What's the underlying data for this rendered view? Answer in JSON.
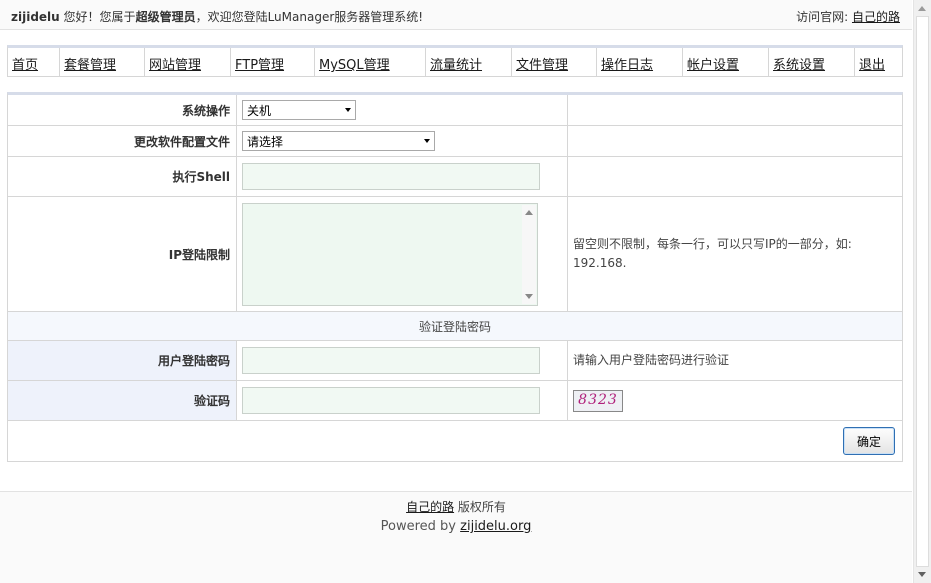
{
  "header": {
    "username": "zijidelu",
    "greeting": "您好！您属于",
    "role": "超级管理员",
    "welcome": "，欢迎您登陆LuManager服务器管理系统!",
    "visit_label": "访问官网:",
    "visit_link": "自己的路"
  },
  "nav": {
    "items": [
      {
        "label": "首页",
        "width": 52
      },
      {
        "label": "套餐管理",
        "width": 85
      },
      {
        "label": "网站管理",
        "width": 86
      },
      {
        "label": "FTP管理",
        "width": 84
      },
      {
        "label": "MySQL管理",
        "width": 111
      },
      {
        "label": "流量统计",
        "width": 86
      },
      {
        "label": "文件管理",
        "width": 85
      },
      {
        "label": "操作日志",
        "width": 86
      },
      {
        "label": "帐户设置",
        "width": 86
      },
      {
        "label": "系统设置",
        "width": 86
      },
      {
        "label": "退出",
        "width": 45
      }
    ]
  },
  "form": {
    "system_op": {
      "label": "系统操作",
      "value": "关机"
    },
    "config_file": {
      "label": "更改软件配置文件",
      "value": "请选择"
    },
    "shell": {
      "label": "执行Shell",
      "value": ""
    },
    "ip_limit": {
      "label": "IP登陆限制",
      "value": "",
      "hint_line1": "留空则不限制，每条一行，可以只写IP的一部分，如:",
      "hint_line2": "192.168."
    },
    "verify_section": "验证登陆密码",
    "password": {
      "label": "用户登陆密码",
      "value": "",
      "hint": "请输入用户登陆密码进行验证"
    },
    "captcha": {
      "label": "验证码",
      "value": "",
      "image_text": "8323"
    },
    "submit_label": "确定"
  },
  "footer": {
    "site_link": "自己的路",
    "rights": "版权所有",
    "powered_by": "Powered by",
    "powered_link": "zijidelu.org"
  }
}
